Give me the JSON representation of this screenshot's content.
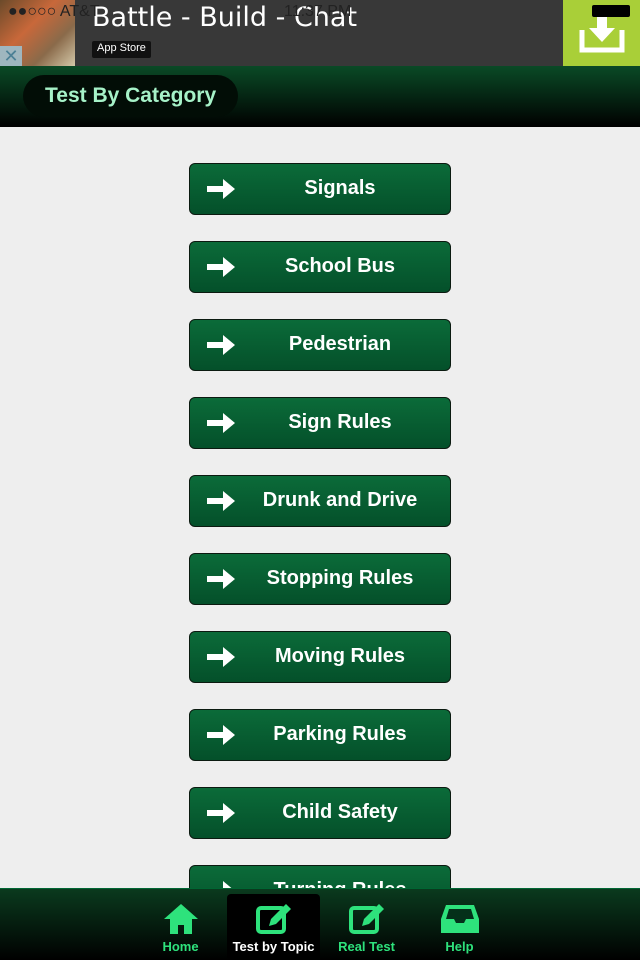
{
  "ad": {
    "title": "Battle - Build - Chat",
    "store_label": "App Store",
    "close": "✕"
  },
  "status": {
    "carrier": "●●○○○ AT&T",
    "time": "11:37 PM"
  },
  "header": {
    "title": "Test By Category"
  },
  "categories": [
    "Signals",
    "School Bus",
    "Pedestrian",
    "Sign Rules",
    "Drunk and Drive",
    "Stopping Rules",
    "Moving Rules",
    "Parking Rules",
    "Child Safety",
    "Turning Rules"
  ],
  "tabs": [
    {
      "label": "Home",
      "icon": "home-icon"
    },
    {
      "label": "Test by Topic",
      "icon": "edit-icon",
      "active": true
    },
    {
      "label": "Real Test",
      "icon": "edit-icon"
    },
    {
      "label": "Help",
      "icon": "inbox-icon"
    }
  ],
  "colors": {
    "accent": "#2ee27c",
    "button": "#0b6b39",
    "ad_download": "#a9cf38"
  }
}
